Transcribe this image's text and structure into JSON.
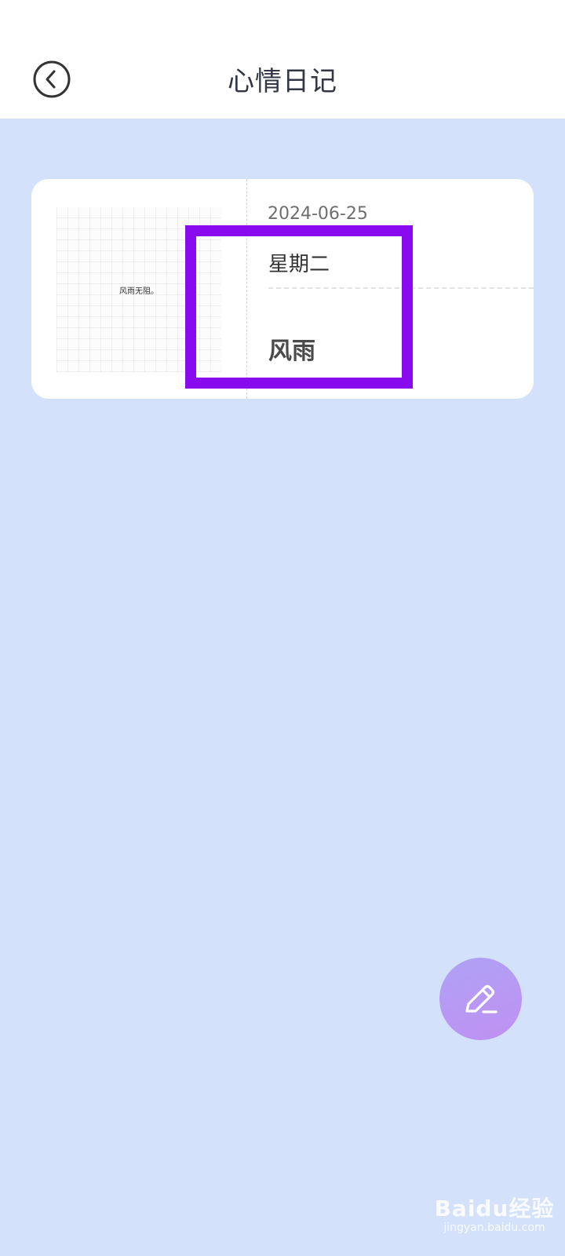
{
  "header": {
    "title": "心情日记",
    "back_icon": "chevron-left-circle-icon"
  },
  "diary_entry": {
    "thumbnail_text": "风雨无阻。",
    "date": "2024-06-25",
    "weekday": "星期二",
    "weather": "风雨"
  },
  "fab": {
    "icon": "pencil-edit-icon"
  },
  "watermark": {
    "logo": "Baidu经验",
    "url": "jingyan.baidu.com"
  },
  "colors": {
    "background": "#d3e1fa",
    "header_bg": "#ffffff",
    "card_bg": "#ffffff",
    "highlight": "#8a0af0",
    "fab_gradient_start": "#aea2f5",
    "fab_gradient_end": "#c090f2"
  }
}
